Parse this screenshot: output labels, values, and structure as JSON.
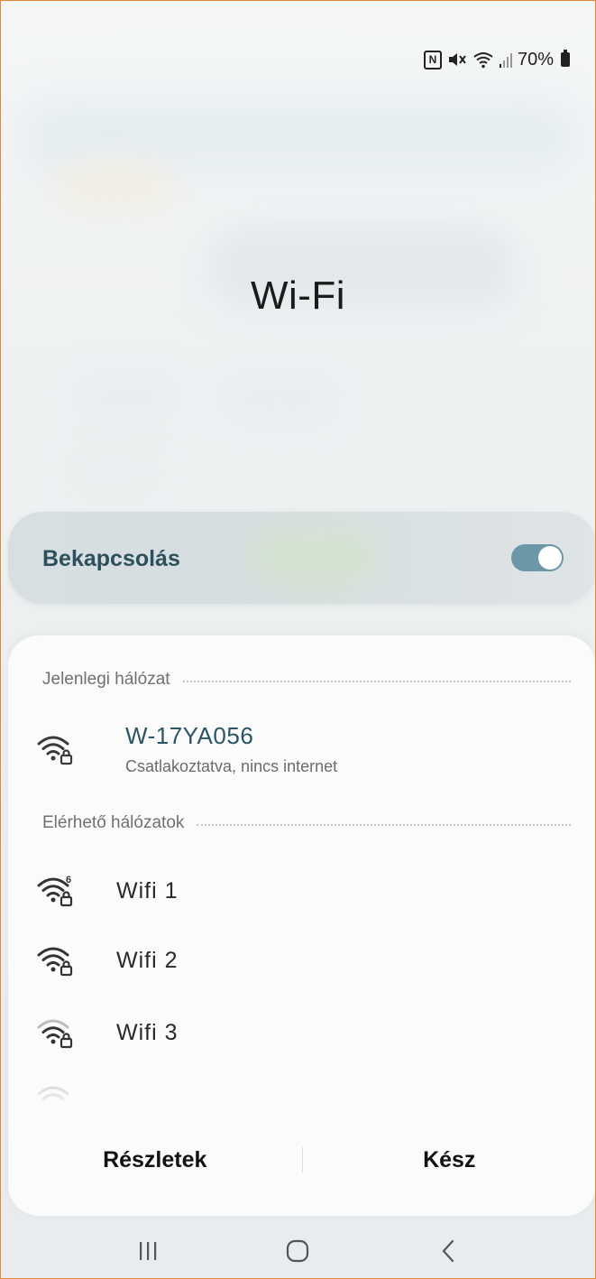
{
  "status_bar": {
    "nfc_icon": "nfc-icon",
    "mute_icon": "mute-icon",
    "wifi_icon": "wifi-icon",
    "signal_icon": "signal-icon",
    "battery_text": "70%",
    "battery_icon": "battery-icon"
  },
  "page": {
    "title": "Wi-Fi"
  },
  "toggle": {
    "label": "Bekapcsolás",
    "state": "on",
    "accent_color": "#6c97a6"
  },
  "sheet": {
    "current_header": "Jelenlegi hálózat",
    "current_network": {
      "name": "W-17YA056",
      "status": "Csatlakoztatva, nincs internet",
      "icon": "wifi-lock-icon"
    },
    "available_header": "Elérhető hálózatok",
    "available_networks": [
      {
        "name": "Wifi 1",
        "icon": "wifi6-lock-icon"
      },
      {
        "name": "Wifi 2",
        "icon": "wifi-lock-icon"
      },
      {
        "name": "Wifi 3",
        "icon": "wifi-lock-icon"
      },
      {
        "name": "",
        "icon": "wifi-icon"
      }
    ],
    "buttons": {
      "details": "Részletek",
      "done": "Kész"
    }
  },
  "nav_bar": {
    "recents": "recents-icon",
    "home": "home-icon",
    "back": "back-icon"
  }
}
